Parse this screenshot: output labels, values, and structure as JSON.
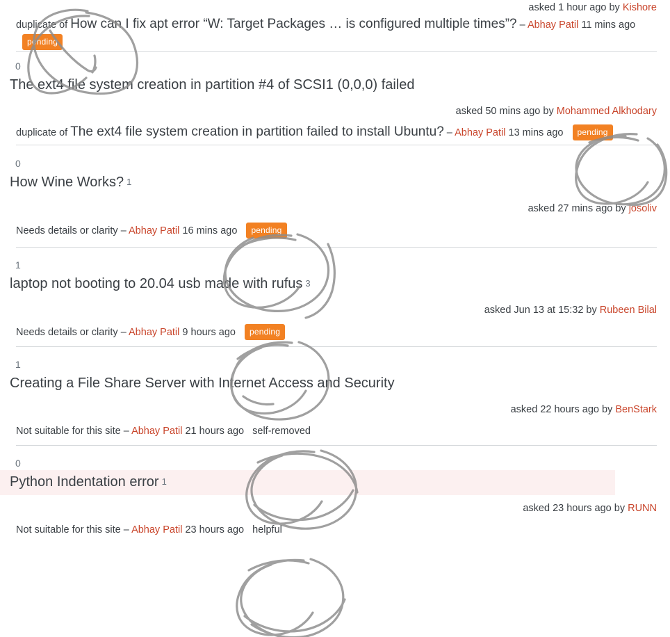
{
  "page": {
    "type": "flag-queue-list",
    "link_color": "#c9452b",
    "badge_color": "#f28123",
    "highlight_row_color": "#fcf0f0",
    "divider_color": "#d6d9dc",
    "text_color": "#3b4045"
  },
  "top_meta": {
    "asked": "asked 1 hour ago by",
    "user": "Kishore"
  },
  "top_reason": {
    "dup_label": "duplicate of",
    "dup_title": "How can I fix apt error “W: Target Packages … is configured multiple times”?",
    "dash": "–",
    "user": "Abhay Patil",
    "time": "11 mins ago",
    "badge": "pending"
  },
  "rows": [
    {
      "votes": "0",
      "title": "The ext4 file system creation in partition #4 of SCSI1 (0,0,0) failed",
      "answers": "",
      "highlight": false,
      "meta": {
        "asked": "asked 50 mins ago by",
        "user": "Mohammed Alkhodary"
      },
      "reason": {
        "kind": "duplicate",
        "dup_label": "duplicate of",
        "dup_title": "The ext4 file system creation in partition failed to install Ubuntu?",
        "dash": "–",
        "user": "Abhay Patil",
        "time": "13 mins ago",
        "badge": "pending",
        "note": ""
      }
    },
    {
      "votes": "0",
      "title": "How Wine Works?",
      "answers": "1",
      "highlight": false,
      "meta": {
        "asked": "asked 27 mins ago by",
        "user": "josoliv"
      },
      "reason": {
        "kind": "reason",
        "reason_text": "Needs details or clarity",
        "dash": "–",
        "user": "Abhay Patil",
        "time": "16 mins ago",
        "badge": "pending",
        "note": ""
      }
    },
    {
      "votes": "1",
      "title": "laptop not booting to 20.04 usb made with rufus",
      "answers": "3",
      "highlight": false,
      "meta": {
        "asked": "asked Jun 13 at 15:32 by",
        "user": "Rubeen Bilal"
      },
      "reason": {
        "kind": "reason",
        "reason_text": "Needs details or clarity",
        "dash": "–",
        "user": "Abhay Patil",
        "time": "9 hours ago",
        "badge": "pending",
        "note": ""
      }
    },
    {
      "votes": "1",
      "title": "Creating a File Share Server with Internet Access and Security",
      "answers": "",
      "highlight": false,
      "meta": {
        "asked": "asked 22 hours ago by",
        "user": "BenStark"
      },
      "reason": {
        "kind": "reason",
        "reason_text": "Not suitable for this site",
        "dash": "–",
        "user": "Abhay Patil",
        "time": "21 hours ago",
        "badge": "",
        "note": "self-removed"
      }
    },
    {
      "votes": "0",
      "title": "Python Indentation error",
      "answers": "1",
      "highlight": true,
      "meta": {
        "asked": "asked 23 hours ago by",
        "user": "RUNN"
      },
      "reason": {
        "kind": "reason",
        "reason_text": "Not suitable for this site",
        "dash": "–",
        "user": "Abhay Patil",
        "time": "23 hours ago",
        "badge": "",
        "note": "helpful"
      }
    }
  ],
  "annotations": {
    "description": "hand-drawn pencil circles over pending badges and notes",
    "count": 6
  }
}
